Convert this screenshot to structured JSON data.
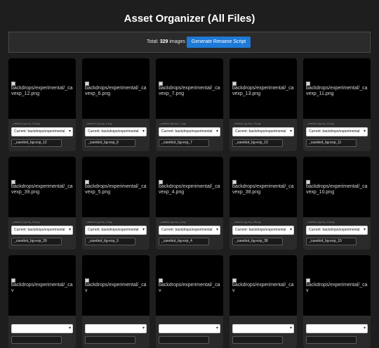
{
  "page": {
    "title": "Asset Organizer (All Files)",
    "total_prefix": "Total:",
    "total_count": "329",
    "total_suffix": "images",
    "rename_button": "Generate Rename Script"
  },
  "cards": [
    {
      "alt": "backdrops/experimental/_cavexp_12.png",
      "file": "_cavebot_bg-exp_12.png",
      "current": "Current: backdrops/experimental",
      "name": "_cavebot_bg-exp_12"
    },
    {
      "alt": "backdrops/experimental/_cavexp_6.png",
      "file": "_cavebot_bg-exp_6.png",
      "current": "Current: backdrops/experimental",
      "name": "_cavebot_bg-exp_6"
    },
    {
      "alt": "backdrops/experimental/_cavexp_7.png",
      "file": "_cavebot_bg-exp_7.png",
      "current": "Current: backdrops/experimental",
      "name": "_cavebot_bg-exp_7"
    },
    {
      "alt": "backdrops/experimental/_cavexp_13.png",
      "file": "_cavebot_bg-exp_13.png",
      "current": "Current: backdrops/experimental",
      "name": "_cavebot_bg-exp_13"
    },
    {
      "alt": "backdrops/experimental/_cavexp_11.png",
      "file": "_cavebot_bg-exp_11.png",
      "current": "Current: backdrops/experimental",
      "name": "_cavebot_bg-exp_11"
    },
    {
      "alt": "backdrops/experimental/_cavexp_39.png",
      "file": "_cavebot_bg-exp_39.png",
      "current": "Current: backdrops/experimental",
      "name": "_cavebot_bg-exp_39"
    },
    {
      "alt": "backdrops/experimental/_cavexp_5.png",
      "file": "_cavebot_bg-exp_5.png",
      "current": "Current: backdrops/experimental",
      "name": "_cavebot_bg-exp_5"
    },
    {
      "alt": "backdrops/experimental/_cavexp_4.png",
      "file": "_cavebot_bg-exp_4.png",
      "current": "Current: backdrops/experimental",
      "name": "_cavebot_bg-exp_4"
    },
    {
      "alt": "backdrops/experimental/_cavexp_38.png",
      "file": "_cavebot_bg-exp_38.png",
      "current": "Current: backdrops/experimental",
      "name": "_cavebot_bg-exp_38"
    },
    {
      "alt": "backdrops/experimental/_cavexp_10.png",
      "file": "_cavebot_bg-exp_10.png",
      "current": "Current: backdrops/experimental",
      "name": "_cavebot_bg-exp_10"
    },
    {
      "alt": "backdrops/experimental/_cav",
      "file": "",
      "current": "",
      "name": ""
    },
    {
      "alt": "backdrops/experimental/_cav",
      "file": "",
      "current": "",
      "name": ""
    },
    {
      "alt": "backdrops/experimental/_cav",
      "file": "",
      "current": "",
      "name": ""
    },
    {
      "alt": "backdrops/experimental/_cav",
      "file": "",
      "current": "",
      "name": ""
    },
    {
      "alt": "backdrops/experimental/_cav",
      "file": "",
      "current": "",
      "name": ""
    }
  ]
}
